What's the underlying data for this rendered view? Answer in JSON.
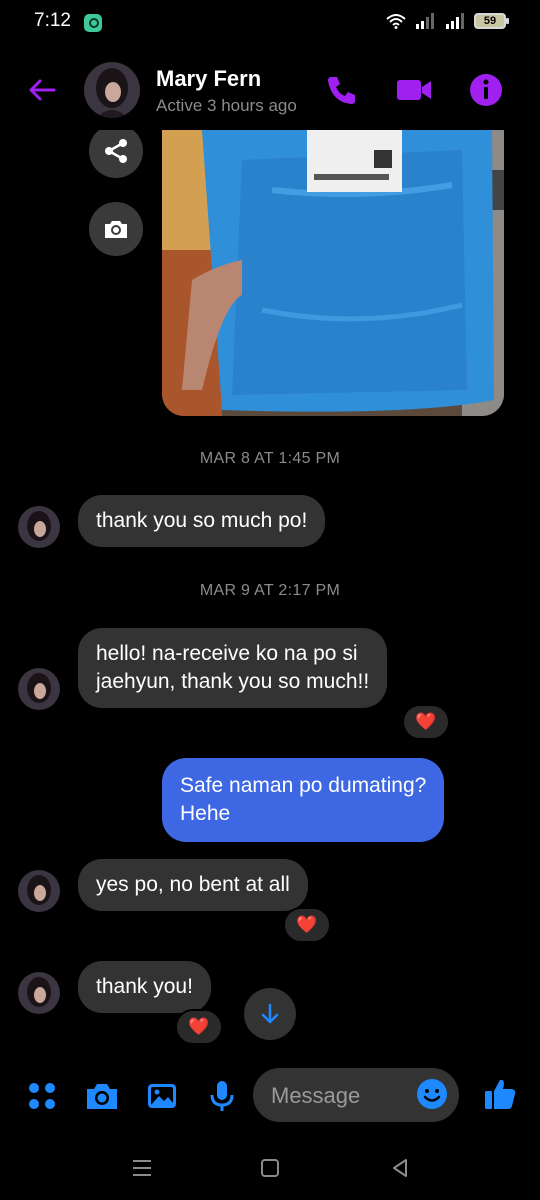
{
  "status_bar": {
    "time": "7:12",
    "battery": "59"
  },
  "header": {
    "name": "Mary Fern",
    "status": "Active 3 hours ago",
    "accent_color": "#a020f0"
  },
  "conversation": {
    "timestamp_1": "MAR 8 AT 1:45 PM",
    "msg_1": "thank you so much po!",
    "timestamp_2": "MAR 9 AT 2:17 PM",
    "msg_2": "hello! na-receive ko na po si\njaehyun, thank you so much!!",
    "msg_2_reaction": "❤️",
    "msg_3_out": "Safe naman po dumating?\nHehe",
    "msg_4": "yes po, no bent at all",
    "msg_4_reaction": "❤️",
    "msg_5": "thank you!",
    "msg_5_reaction": "❤️",
    "outgoing_color": "#3d67e3"
  },
  "composer": {
    "placeholder": "Message",
    "icon_color": "#1e88ff"
  },
  "icons": [
    "back-arrow-icon",
    "phone-icon",
    "video-icon",
    "info-icon",
    "share-icon",
    "camera-icon",
    "apps-grid-icon",
    "gallery-icon",
    "microphone-icon",
    "emoji-icon",
    "thumbs-up-icon",
    "arrow-down-icon"
  ]
}
